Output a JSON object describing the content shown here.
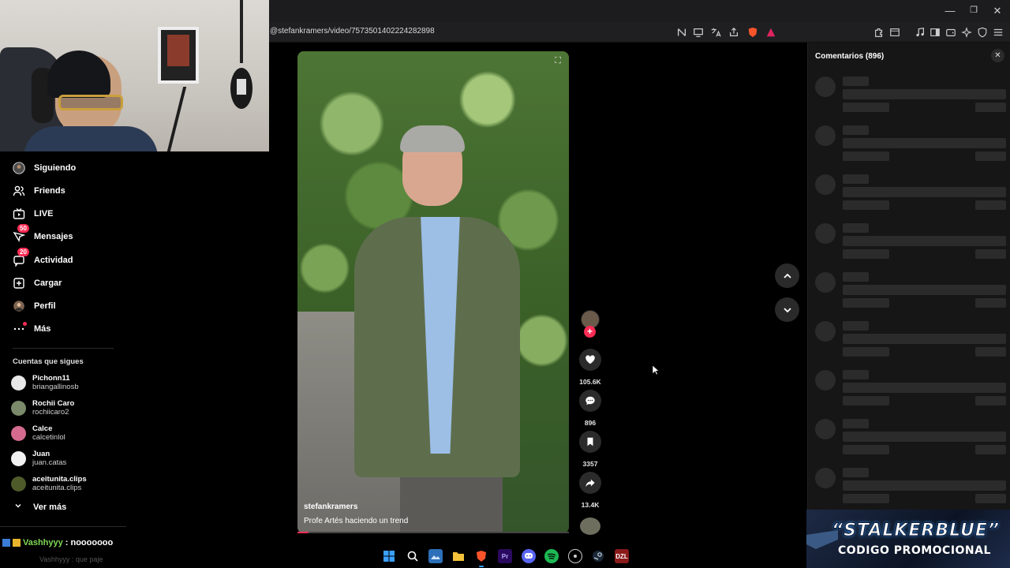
{
  "browser": {
    "url": "@stefankramers/video/7573501402224282898",
    "window_controls": [
      "minimize",
      "restore",
      "close"
    ],
    "toolbar_icons": [
      "no-translate-icon",
      "cast-icon",
      "translate-icon",
      "share-icon",
      "brave-shield-icon",
      "brave-rewards-icon",
      "extensions-icon",
      "tab-search-icon",
      "music-icon",
      "sidebar-icon",
      "wallet-icon",
      "leo-ai-icon",
      "vpn-icon",
      "menu-icon"
    ]
  },
  "sidebar": {
    "nav": [
      {
        "label": "Siguiendo",
        "icon": "following-avatar-icon"
      },
      {
        "label": "Friends",
        "icon": "friends-icon"
      },
      {
        "label": "LIVE",
        "icon": "live-tv-icon"
      },
      {
        "label": "Mensajes",
        "icon": "messages-icon",
        "badge": "50"
      },
      {
        "label": "Actividad",
        "icon": "activity-icon",
        "badge": "20"
      },
      {
        "label": "Cargar",
        "icon": "upload-plus-icon"
      },
      {
        "label": "Perfil",
        "icon": "profile-avatar-icon"
      },
      {
        "label": "Más",
        "icon": "more-dots-icon"
      }
    ],
    "following_title": "Cuentas que sigues",
    "accounts": [
      {
        "name": "Pichonn11",
        "handle": "briangallinosb",
        "color": "#e8e8e8"
      },
      {
        "name": "Rochii Caro",
        "handle": "rochiicaro2",
        "color": "#7a8a6a"
      },
      {
        "name": "Calce",
        "handle": "calcetinlol",
        "color": "#d46b8f"
      },
      {
        "name": "Juan",
        "handle": "juan.catas",
        "color": "#f2f2f2"
      },
      {
        "name": "aceitunita.clips",
        "handle": "aceitunita.clips",
        "color": "#4e5a2a"
      }
    ],
    "see_more": "Ver más"
  },
  "chat": {
    "user": "Vashhyyy",
    "message": ": nooooooo",
    "faded": "Vashhyyy : que paje"
  },
  "video": {
    "username": "stefankramers",
    "description": "Profe Artés haciendo un trend",
    "progress": 0.04
  },
  "actions": {
    "likes": "105.6K",
    "comments": "896",
    "saves": "3357",
    "shares": "13.4K"
  },
  "comments_panel": {
    "title": "Comentarios (896)",
    "skeleton_rows": 9
  },
  "promo": {
    "line1": "“STALKERBLUE”",
    "line2": "CODIGO PROMOCIONAL"
  },
  "taskbar": {
    "apps": [
      "windows-start-icon",
      "search-icon",
      "gallery-icon",
      "file-explorer-icon",
      "brave-browser-icon",
      "premiere-pro-icon",
      "discord-icon",
      "spotify-icon",
      "chrome-like-icon",
      "steam-icon",
      "dzl-app-icon"
    ],
    "premiere_label": "Pr",
    "dzl_label": "DZL"
  },
  "colors": {
    "accent": "#fe2c55",
    "panel": "#161616",
    "skeleton": "#2b2b2b"
  }
}
